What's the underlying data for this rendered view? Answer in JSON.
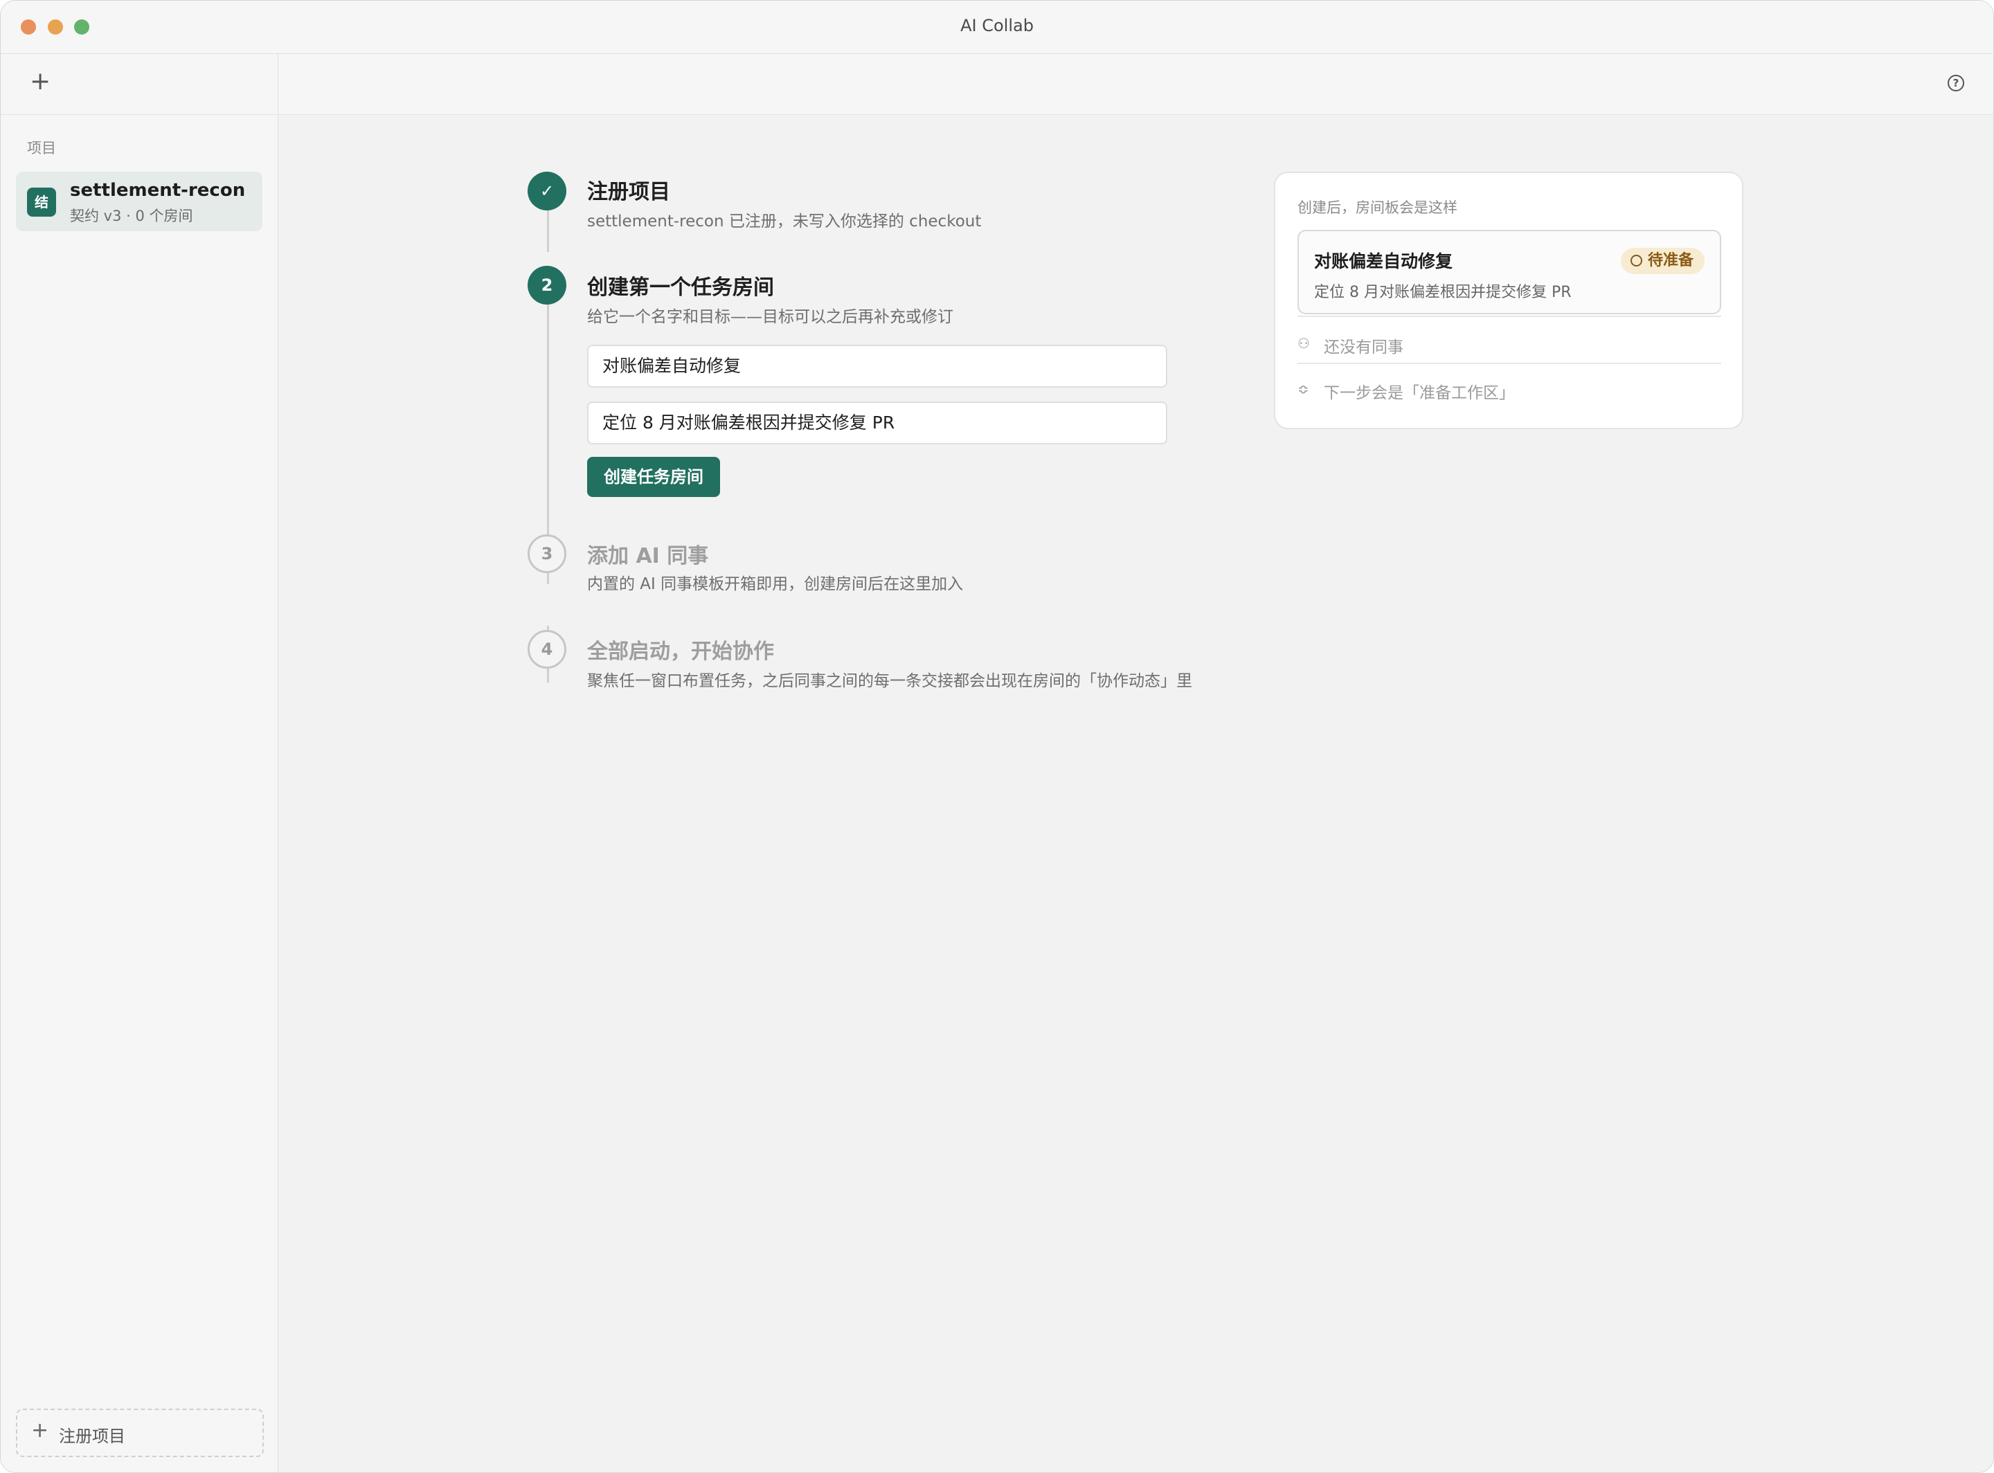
{
  "window": {
    "title": "AI Collab"
  },
  "sidebar": {
    "add_label": "+",
    "section_label": "项目",
    "projects": [
      {
        "icon_text": "结",
        "name": "settlement-recon",
        "subtitle": "契约 v3 · 0 个房间"
      }
    ],
    "register_plus": "+",
    "register_label": "注册项目"
  },
  "toolbar": {
    "help_icon": "?"
  },
  "steps": [
    {
      "marker": "✓",
      "title": "注册项目",
      "desc": "settlement-recon 已注册，未写入你选择的 checkout",
      "status": "done"
    },
    {
      "marker": "2",
      "title": "创建第一个任务房间",
      "desc": "给它一个名字和目标——目标可以之后再补充或修订",
      "status": "active",
      "name_value": "对账偏差自动修复",
      "goal_value": "定位 8 月对账偏差根因并提交修复 PR",
      "button_label": "创建任务房间"
    },
    {
      "marker": "3",
      "title": "添加 AI 同事",
      "desc": "内置的 AI 同事模板开箱即用，创建房间后在这里加入",
      "status": "pending"
    },
    {
      "marker": "4",
      "title": "全部启动，开始协作",
      "desc": "聚焦任一窗口布置任务，之后同事之间的每一条交接都会出现在房间的「协作动态」里",
      "status": "pending"
    }
  ],
  "preview": {
    "caption": "创建后，房间板会是这样",
    "room_title": "对账偏差自动修复",
    "room_goal": "定位 8 月对账偏差根因并提交修复 PR",
    "badge": "待准备",
    "row1_icon": "people-icon",
    "row1": "还没有同事",
    "row2_icon": "layers-icon",
    "row2": "下一步会是「准备工作区」"
  },
  "colors": {
    "accent": "#22705f",
    "badge_bg": "#f7ecd2",
    "badge_text": "#8a5a14"
  }
}
